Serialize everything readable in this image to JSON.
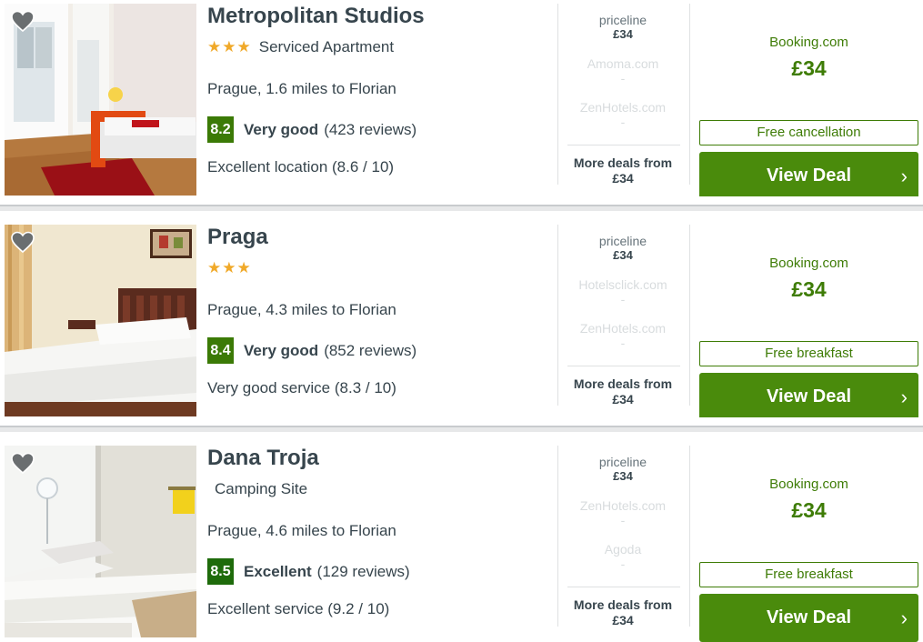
{
  "colors": {
    "accent_green": "#4a8b0c",
    "text_green": "#3e7c06",
    "star": "#f0a929",
    "text": "#37454d"
  },
  "hotels": [
    {
      "name": "Metropolitan Studios",
      "stars": "★★★",
      "type": "Serviced Apartment",
      "location": "Prague, 1.6 miles to Florian",
      "score": "8.2",
      "rating_word": "Very good",
      "reviews": "(423 reviews)",
      "highlight": "Excellent location (8.6 / 10)",
      "deals": [
        {
          "provider": "priceline",
          "price": "£34"
        },
        {
          "provider": "Amoma.com",
          "price": "-"
        },
        {
          "provider": "ZenHotels.com",
          "price": "-"
        }
      ],
      "more_label": "More deals from",
      "more_price": "£34",
      "main_provider": "Booking.com",
      "main_price": "£34",
      "perk": "Free cancellation",
      "cta": "View Deal",
      "icon": "heart-icon"
    },
    {
      "name": "Praga",
      "stars": "★★★",
      "type": "",
      "location": "Prague, 4.3 miles to Florian",
      "score": "8.4",
      "rating_word": "Very good",
      "reviews": "(852 reviews)",
      "highlight": "Very good service (8.3 / 10)",
      "deals": [
        {
          "provider": "priceline",
          "price": "£34"
        },
        {
          "provider": "Hotelsclick.com",
          "price": "-"
        },
        {
          "provider": "ZenHotels.com",
          "price": "-"
        }
      ],
      "more_label": "More deals from",
      "more_price": "£34",
      "main_provider": "Booking.com",
      "main_price": "£34",
      "perk": "Free breakfast",
      "cta": "View Deal",
      "icon": "heart-icon"
    },
    {
      "name": "Dana Troja",
      "stars": "",
      "type": "Camping Site",
      "location": "Prague, 4.6 miles to Florian",
      "score": "8.5",
      "rating_word": "Excellent",
      "reviews": "(129 reviews)",
      "highlight": "Excellent service (9.2 / 10)",
      "deals": [
        {
          "provider": "priceline",
          "price": "£34"
        },
        {
          "provider": "ZenHotels.com",
          "price": "-"
        },
        {
          "provider": "Agoda",
          "price": "-"
        }
      ],
      "more_label": "More deals from",
      "more_price": "£34",
      "main_provider": "Booking.com",
      "main_price": "£34",
      "perk": "Free breakfast",
      "cta": "View Deal",
      "icon": "heart-icon"
    }
  ]
}
